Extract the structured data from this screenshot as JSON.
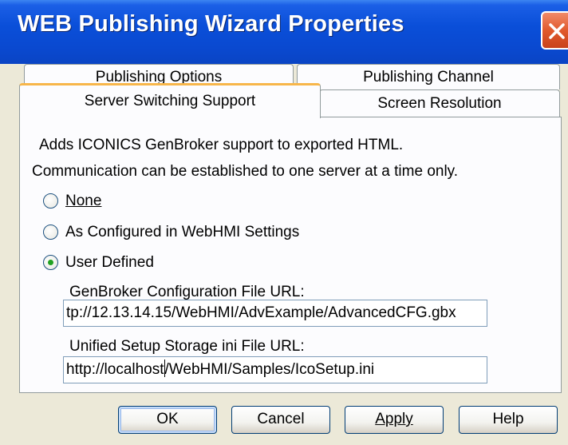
{
  "window": {
    "title": "WEB Publishing Wizard Properties"
  },
  "tabs": {
    "publishing_options": "Publishing Options",
    "publishing_channel": "Publishing Channel",
    "server_switching": "Server Switching Support",
    "screen_resolution": "Screen Resolution",
    "active": "Server Switching Support"
  },
  "panel": {
    "description_line1": "Adds ICONICS GenBroker support to exported HTML.",
    "description_line2": "Communication can be established to one server at a time only.",
    "radio_none": "None",
    "radio_configured": "As Configured in WebHMI Settings",
    "radio_user_defined": "User Defined",
    "selected_radio": "User Defined",
    "genbroker_label": "GenBroker Configuration File URL:",
    "genbroker_value": "tp://12.13.14.15/WebHMI/AdvExample/AdvancedCFG.gbx",
    "unified_label": "Unified Setup Storage ini File URL:",
    "unified_value_before_caret": "http://localhost",
    "unified_value_after_caret": "/WebHMI/Samples/IcoSetup.ini"
  },
  "buttons": {
    "ok": "OK",
    "cancel": "Cancel",
    "apply": "Apply",
    "help": "Help"
  },
  "colors": {
    "titlebar": "#0a4fd9",
    "close_button": "#e15a2d",
    "dialog_bg": "#ece9d8",
    "active_tab_accent": "#f7b64a",
    "radio_selected": "#21a121"
  }
}
